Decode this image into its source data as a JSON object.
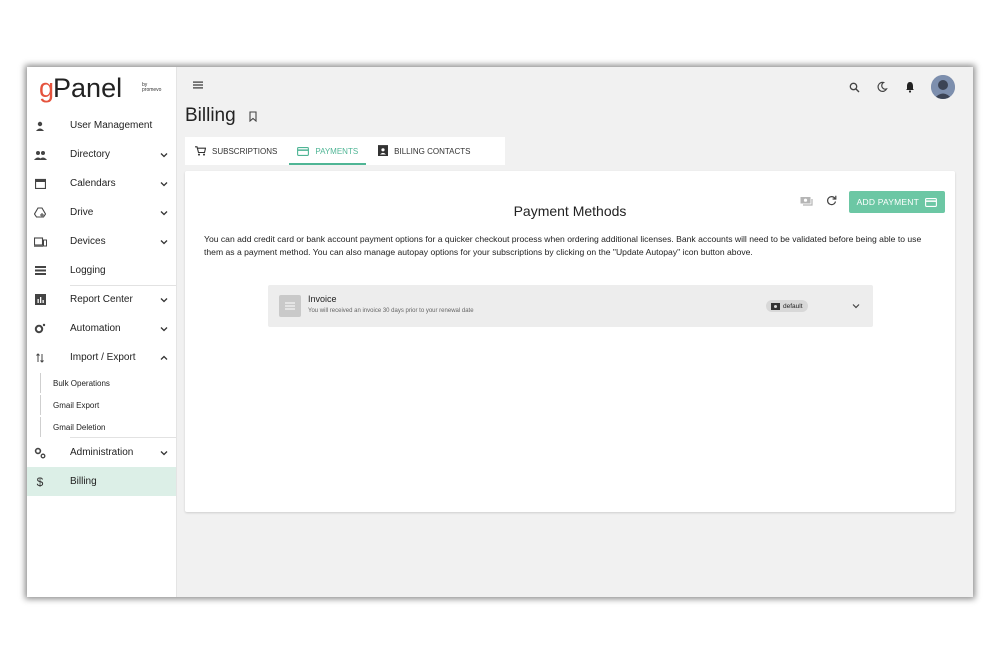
{
  "app": {
    "logo_letter": "g",
    "logo_rest": "Panel",
    "logo_by": "by",
    "logo_brand": "promevo"
  },
  "sidebar": {
    "items": [
      {
        "label": "User Management",
        "icon": "person-icon"
      },
      {
        "label": "Directory",
        "icon": "people-icon"
      },
      {
        "label": "Calendars",
        "icon": "calendar-icon"
      },
      {
        "label": "Drive",
        "icon": "drive-icon"
      },
      {
        "label": "Devices",
        "icon": "devices-icon"
      },
      {
        "label": "Logging",
        "icon": "list-icon"
      },
      {
        "label": "Report Center",
        "icon": "chart-icon"
      },
      {
        "label": "Automation",
        "icon": "gear-automation-icon"
      },
      {
        "label": "Import / Export",
        "icon": "import-export-icon"
      },
      {
        "label": "Administration",
        "icon": "gears-icon"
      },
      {
        "label": "Billing",
        "icon": "dollar-icon"
      }
    ],
    "sub_items": [
      "Bulk Operations",
      "Gmail Export",
      "Gmail Deletion"
    ]
  },
  "header": {
    "title": "Billing"
  },
  "tabs": [
    {
      "label": "SUBSCRIPTIONS"
    },
    {
      "label": "PAYMENTS"
    },
    {
      "label": "BILLING CONTACTS"
    }
  ],
  "payments": {
    "title": "Payment Methods",
    "add_button": "ADD PAYMENT",
    "description": "You can add credit card or bank account payment options for a quicker checkout process when ordering additional licenses. Bank accounts will need to be validated before being able to use them as a payment method. You can also manage autopay options for your subscriptions by clicking on the \"Update Autopay\" icon button above.",
    "methods": [
      {
        "name": "Invoice",
        "detail": "You will received an invoice 30 days prior to your renewal date",
        "badge": "default"
      }
    ]
  },
  "colors": {
    "accent": "#4fb595",
    "button": "#6cc7a4",
    "active_nav": "#dcefe7",
    "logo_g": "#e5533d"
  }
}
